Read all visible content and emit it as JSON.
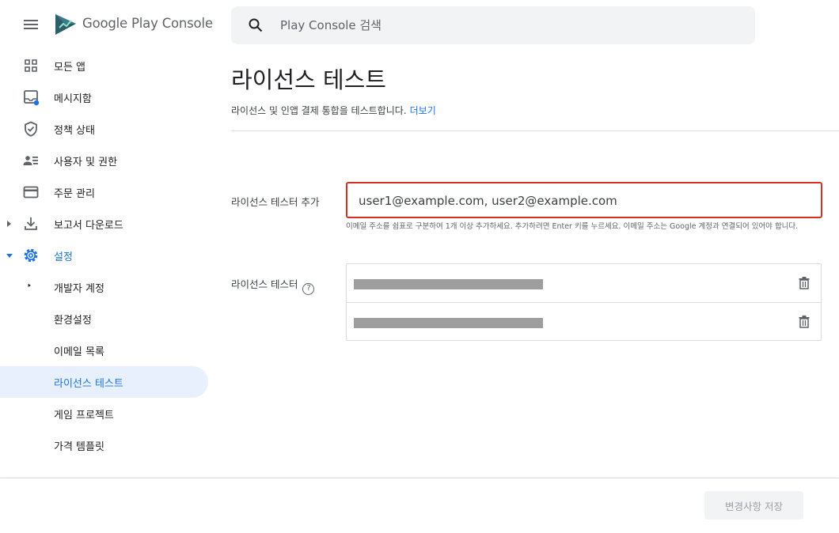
{
  "app": {
    "brand": "Google Play",
    "product": "Console"
  },
  "search": {
    "placeholder": "Play Console 검색"
  },
  "sidebar": {
    "items": [
      {
        "label": "모든 앱",
        "icon": "apps-grid-icon"
      },
      {
        "label": "메시지함",
        "icon": "inbox-icon"
      },
      {
        "label": "정책 상태",
        "icon": "shield-check-icon"
      },
      {
        "label": "사용자 및 권한",
        "icon": "people-list-icon"
      },
      {
        "label": "주문 관리",
        "icon": "credit-card-icon"
      },
      {
        "label": "보고서 다운로드",
        "icon": "download-icon"
      },
      {
        "label": "설정",
        "icon": "settings-gear-icon"
      },
      {
        "label": "개발자 계정"
      },
      {
        "label": "환경설정"
      },
      {
        "label": "이메일 목록"
      },
      {
        "label": "라이선스 테스트"
      },
      {
        "label": "게임 프로젝트"
      },
      {
        "label": "가격 템플릿"
      }
    ]
  },
  "page": {
    "title": "라이선스 테스트",
    "subtitle": "라이선스 및 인앱 결제 통합을 테스트합니다.",
    "learn_more": "더보기"
  },
  "form": {
    "add_label": "라이선스 테스터 추가",
    "add_placeholder": "user1@example.com, user2@example.com",
    "add_helper": "이메일 주소를 쉼표로 구분하여 1개 이상 추가하세요. 추가하려면 Enter 키를 누르세요. 이메일 주소는 Google 계정과 연결되어 있어야 합니다.",
    "testers_label": "라이선스 테스터",
    "help_glyph": "?",
    "testers": [
      {
        "email": ""
      },
      {
        "email": ""
      }
    ]
  },
  "footer": {
    "save_label": "변경사항 저장"
  },
  "colors": {
    "accent": "#1a73e8",
    "active_bg": "#e8f0fe",
    "error_border": "#d93025",
    "redaction": "#9e9e9e"
  }
}
